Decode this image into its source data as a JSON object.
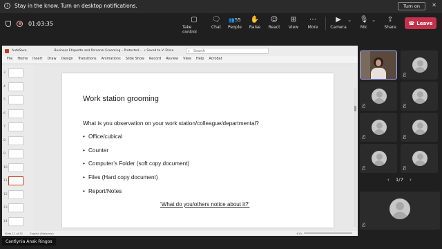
{
  "notification": {
    "message": "Stay in the know. Turn on desktop notifications.",
    "turn_on_label": "Turn on",
    "close_glyph": "✕"
  },
  "meeting": {
    "timer": "01:03:35",
    "people_count": "55"
  },
  "toolbar": {
    "take_control": "Take control",
    "chat": "Chat",
    "people": "People",
    "raise": "Raise",
    "react": "React",
    "view": "View",
    "more": "More",
    "camera": "Camera",
    "mic": "Mic",
    "share": "Share",
    "leave": "Leave"
  },
  "ppt": {
    "autosave": "AutoSave",
    "file_title": "Business Etiquette and Personal Grooming – Protected...",
    "saved": "• Saved to V: Drive",
    "search_placeholder": "Search",
    "menu": [
      "File",
      "Home",
      "Insert",
      "Draw",
      "Design",
      "Transitions",
      "Animations",
      "Slide Show",
      "Record",
      "Review",
      "View",
      "Help",
      "Acrobat"
    ],
    "thumb_numbers": [
      "3",
      "4",
      "5",
      "6",
      "7",
      "8",
      "9",
      "10",
      "11",
      "12",
      "13",
      "14"
    ],
    "selected_slide": "11",
    "status_left": "Slide 11 of 51",
    "status_lang": "English (Malaysia)",
    "zoom": "61%"
  },
  "slide": {
    "title": "Work station grooming",
    "question": "What is you observation on your work station/colleague/departmental?",
    "bullets": [
      "Office/cubical",
      "Counter",
      "Computer’s Folder (soft copy document)",
      "Files (Hard copy document)",
      "Report/Notes"
    ],
    "notice": "‘What do you/others notice about it?’"
  },
  "presenter_name": "Cantlynia Anak Ringos",
  "pager": {
    "label": "1/7",
    "prev_glyph": "‹",
    "next_glyph": "›"
  },
  "icons": {
    "mute": "mic-off-icon",
    "raise": "hand-icon",
    "react": "smile-icon",
    "chat": "chat-icon",
    "view": "grid-icon",
    "more": "more-icon",
    "camera": "camera-icon",
    "share": "share-icon",
    "leave": "phone-icon"
  },
  "colors": {
    "leave": "#c4314b",
    "active_tile_border": "#9ea6ff",
    "selected_thumb": "#c43e1c"
  }
}
